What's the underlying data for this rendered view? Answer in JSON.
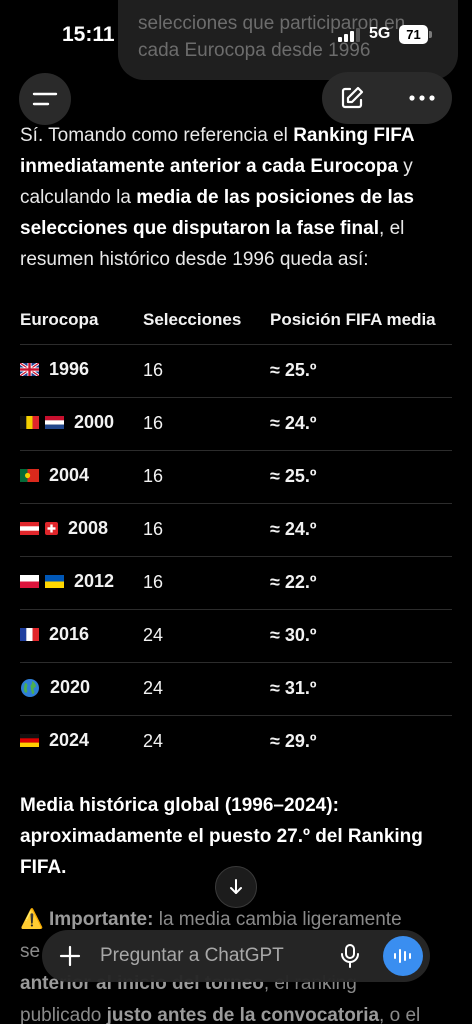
{
  "status_bar": {
    "time": "15:11",
    "network": "5G",
    "battery": "71"
  },
  "user_bubble": {
    "line1": "selecciones que participaron en",
    "line2": "cada Eurocopa desde 1996"
  },
  "intro": {
    "p1": "Sí. Tomando como referencia el ",
    "b1": "Ranking FIFA inmediatamente anterior a cada Eurocopa",
    "p2": " y calculando la ",
    "b2": "media de las posiciones de las selecciones que disputaron la fase final",
    "p3": ", el resumen histórico desde 1996 queda así:"
  },
  "table": {
    "headers": [
      "Eurocopa",
      "Selecciones",
      "Posición FIFA media"
    ],
    "rows": [
      {
        "flags": [
          "gb"
        ],
        "year": "1996",
        "teams": "16",
        "avg": "≈ 25.º"
      },
      {
        "flags": [
          "be",
          "nl"
        ],
        "year": "2000",
        "teams": "16",
        "avg": "≈ 24.º"
      },
      {
        "flags": [
          "pt"
        ],
        "year": "2004",
        "teams": "16",
        "avg": "≈ 25.º"
      },
      {
        "flags": [
          "at",
          "ch"
        ],
        "year": "2008",
        "teams": "16",
        "avg": "≈ 24.º"
      },
      {
        "flags": [
          "pl",
          "ua"
        ],
        "year": "2012",
        "teams": "16",
        "avg": "≈ 22.º"
      },
      {
        "flags": [
          "fr"
        ],
        "year": "2016",
        "teams": "24",
        "avg": "≈ 30.º"
      },
      {
        "flags": [
          "globe"
        ],
        "year": "2020",
        "teams": "24",
        "avg": "≈ 31.º"
      },
      {
        "flags": [
          "de"
        ],
        "year": "2024",
        "teams": "24",
        "avg": "≈ 29.º"
      }
    ]
  },
  "summary": "Media histórica global (1996–2024): aproximadamente el puesto 27.º del Ranking FIFA.",
  "faded": {
    "warn_label": "Importante:",
    "line1_rest": " la media cambia ligeramente",
    "line2": "se",
    "line3_b": "anterior al inicio del torneo",
    "line3_rest": ", el ranking",
    "line4_a": "publicado ",
    "line4_b": "justo antes de la convocatoria",
    "line4_rest": ", o el"
  },
  "composer": {
    "placeholder": "Preguntar a ChatGPT"
  },
  "colors": {
    "accent": "#3a8ef0",
    "background": "#000000",
    "warning": "#c9a227"
  },
  "icons": [
    "menu-icon",
    "edit-icon",
    "more-icon",
    "chevron-down-icon",
    "plus-icon",
    "mic-icon",
    "voice-wave-icon",
    "warning-icon"
  ]
}
